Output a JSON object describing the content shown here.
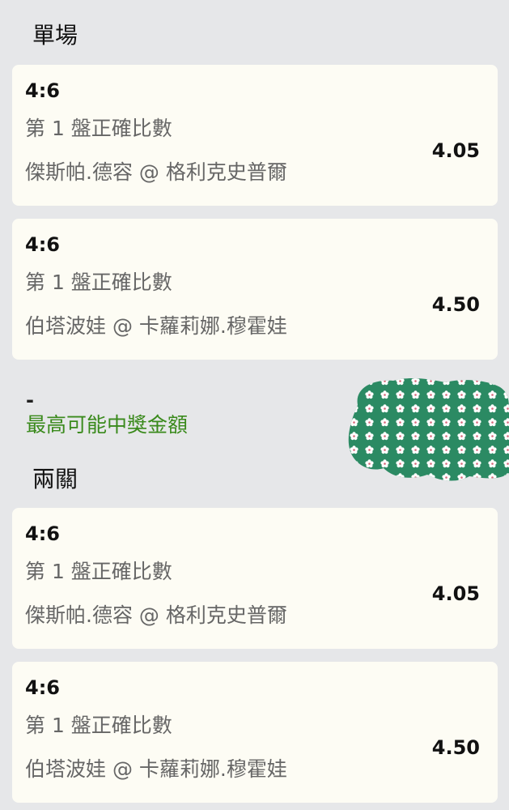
{
  "singles": {
    "title": "單場",
    "cards": [
      {
        "score": "4:6",
        "market": "第 1 盤正確比數",
        "match": "傑斯帕.德容 @ 格利克史普爾",
        "odds": "4.05"
      },
      {
        "score": "4:6",
        "market": "第 1 盤正確比數",
        "match": "伯塔波娃 @ 卡蘿莉娜.穆霍娃",
        "odds": "4.50"
      }
    ]
  },
  "payout": {
    "value": "-",
    "label": "最高可能中獎金額"
  },
  "doubles": {
    "title": "兩關",
    "cards": [
      {
        "score": "4:6",
        "market": "第 1 盤正確比數",
        "match": "傑斯帕.德容 @ 格利克史普爾",
        "odds": "4.05"
      },
      {
        "score": "4:6",
        "market": "第 1 盤正確比數",
        "match": "伯塔波娃 @ 卡蘿莉娜.穆霍娃",
        "odds": "4.50"
      }
    ]
  },
  "colors": {
    "page_bg": "#e6e7e9",
    "card_bg": "#fdfcf4",
    "payout_label": "#3a8a1c",
    "blob_green": "#2b8a63"
  }
}
